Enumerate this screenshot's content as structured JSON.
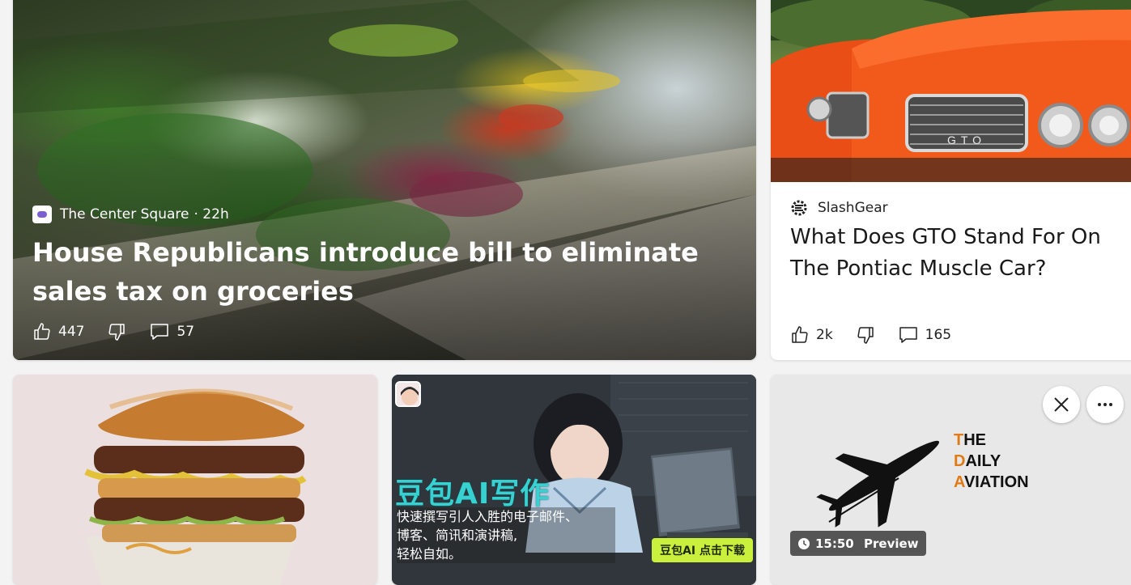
{
  "hero": {
    "source": "The Center Square",
    "age": "· 22h",
    "title": "House Republicans introduce bill to eliminate sales tax on groceries",
    "likes": "447",
    "comments": "57"
  },
  "gto": {
    "source": "SlashGear",
    "title": "What Does GTO Stand For On The Pontiac Muscle Car?",
    "likes": "2k",
    "comments": "165",
    "grille_text": "GTO"
  },
  "doubao": {
    "title": "豆包AI写作",
    "desc_line1": "快速撰写引人入胜的电子邮件、",
    "desc_line2": "博客、简讯和演讲稿,",
    "desc_line3": "轻松自如。",
    "cta": "豆包AI 点击下载"
  },
  "aviation": {
    "logo_line1_first": "T",
    "logo_line1_rest": "HE",
    "logo_line2_first": "D",
    "logo_line2_rest": "AILY",
    "logo_line3_first": "A",
    "logo_line3_rest": "VIATION",
    "duration": "15:50",
    "preview_label": "Preview"
  },
  "colors": {
    "accent_orange": "#e07a14",
    "doubao_cyan": "#38d1d1",
    "doubao_cta": "#c8f03c",
    "car_orange": "#f25a1b"
  }
}
